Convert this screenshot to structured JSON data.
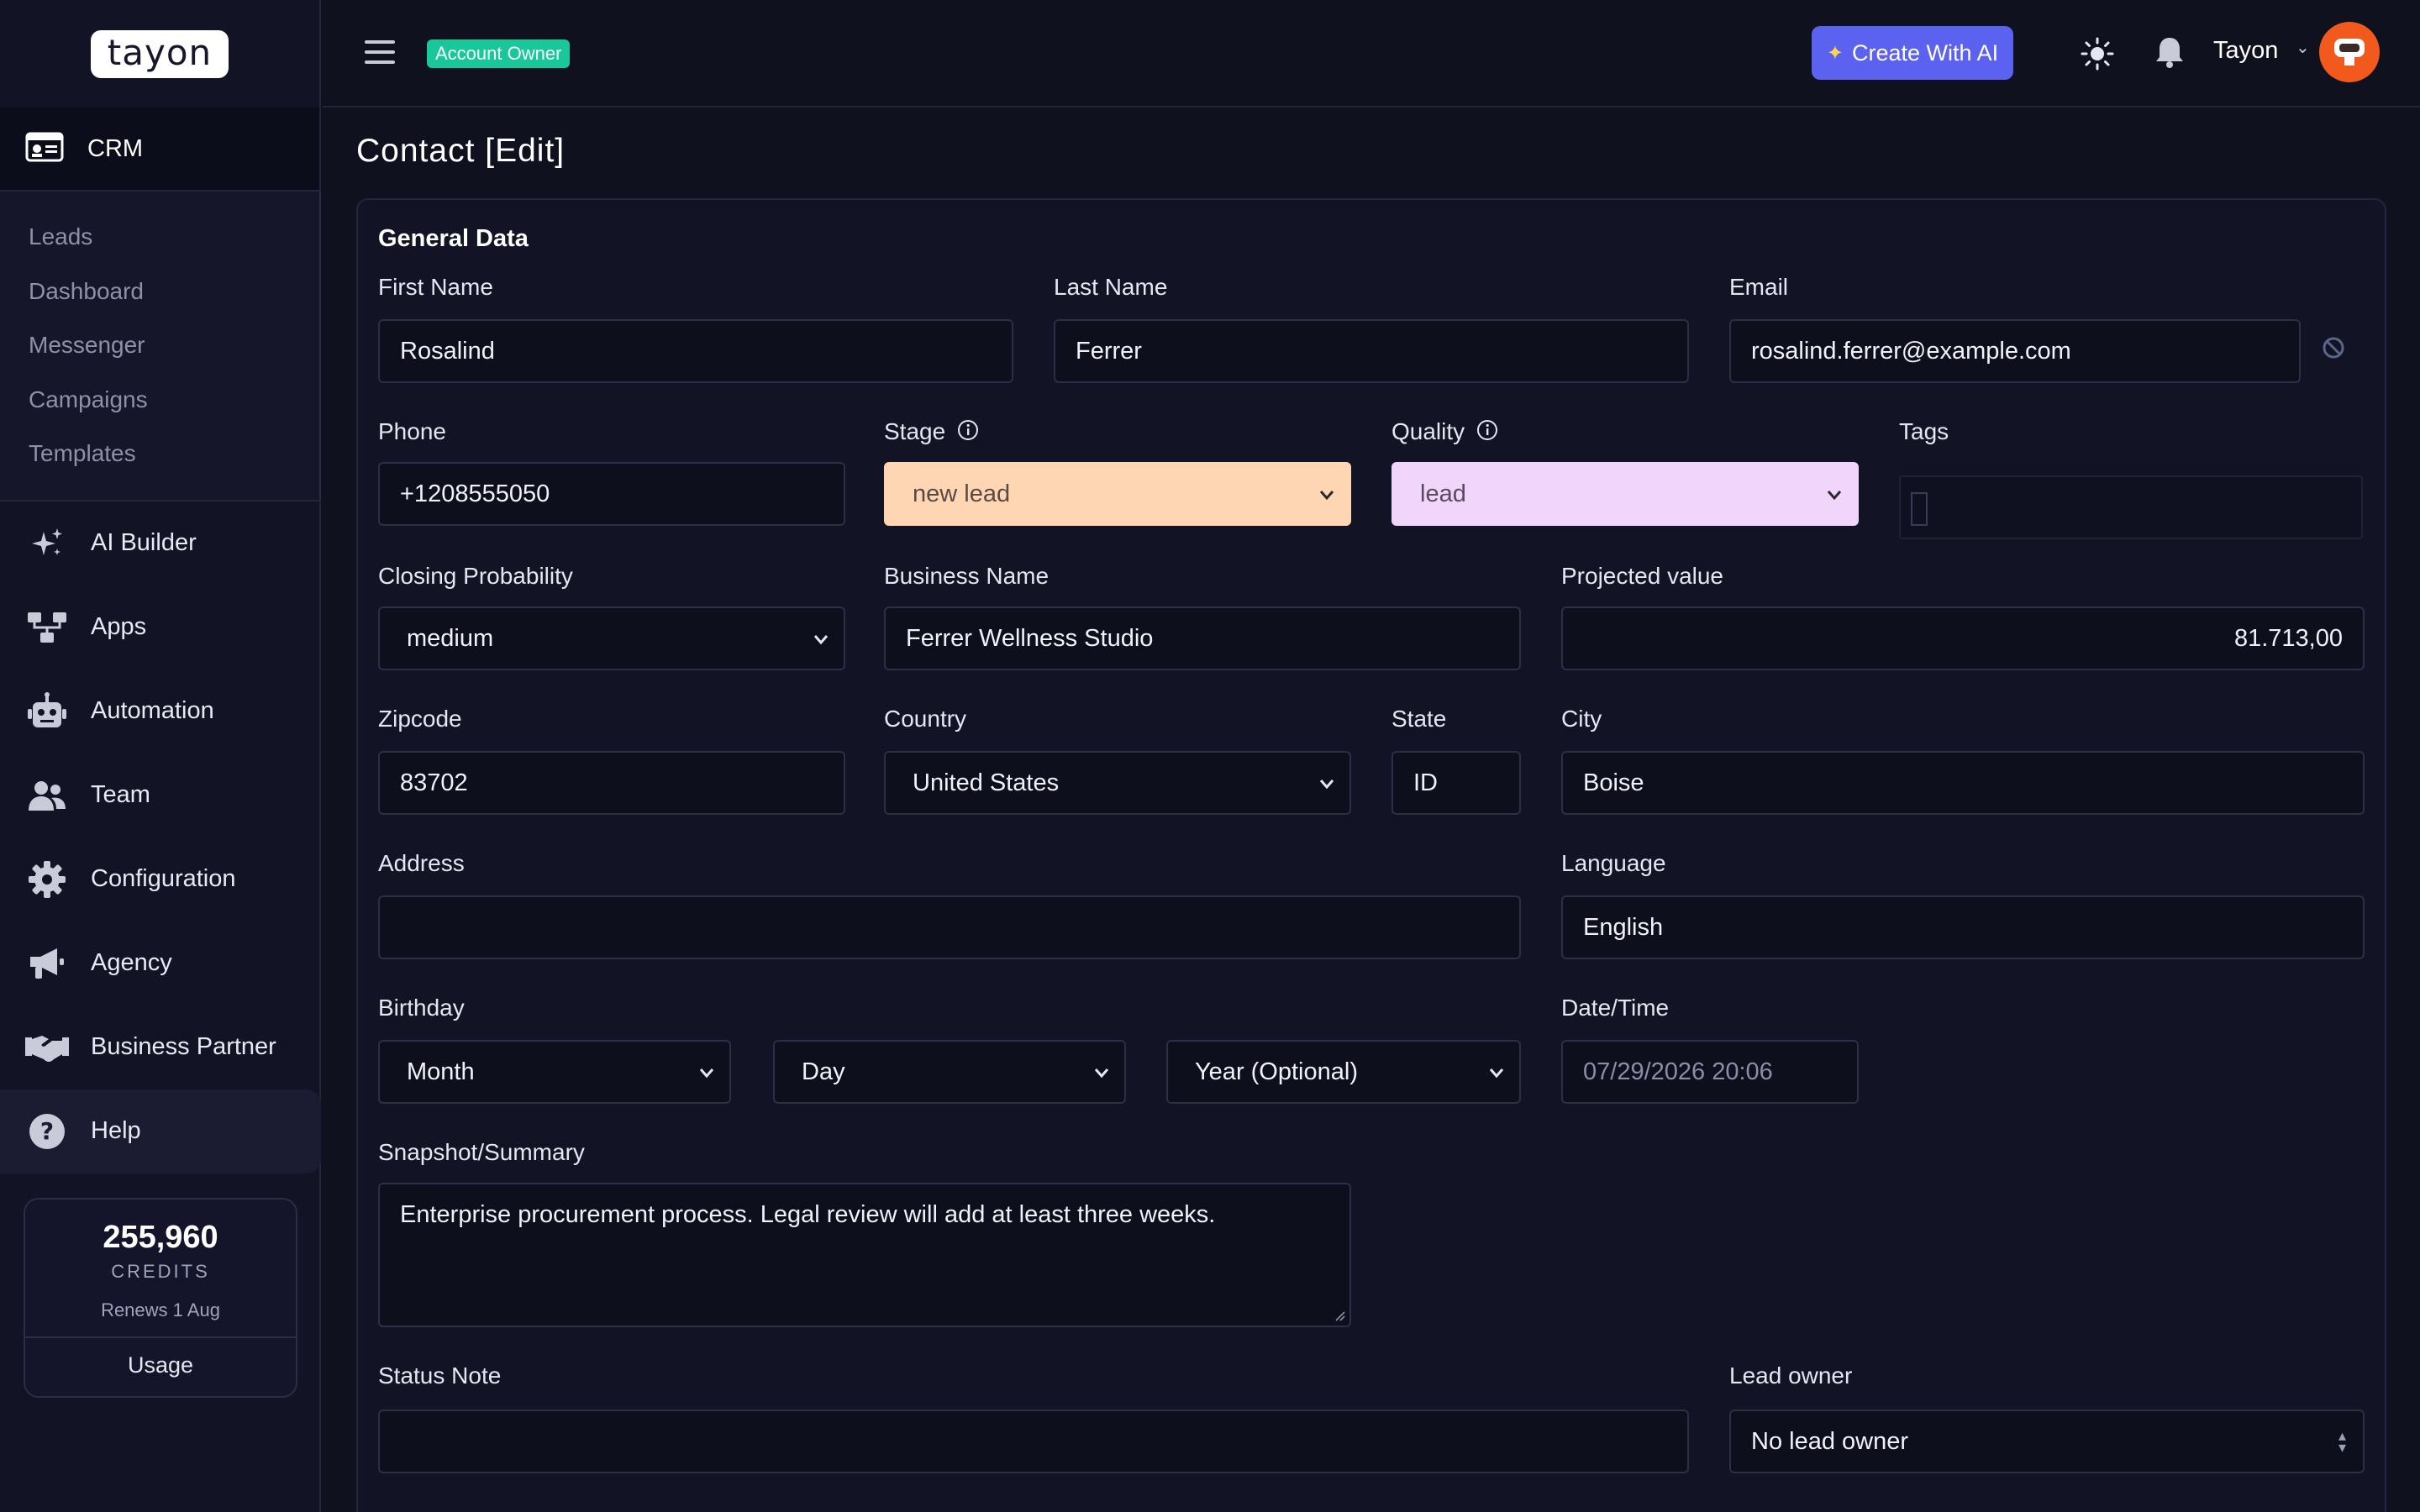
{
  "brand": {
    "logo_text": "tayon"
  },
  "sidebar": {
    "section": {
      "label": "CRM",
      "icon": "id-card-icon"
    },
    "subitems": [
      "Leads",
      "Dashboard",
      "Messenger",
      "Campaigns",
      "Templates"
    ],
    "items": [
      {
        "label": "AI Builder",
        "icon": "sparkles-icon"
      },
      {
        "label": "Apps",
        "icon": "sitemap-icon"
      },
      {
        "label": "Automation",
        "icon": "robot-icon"
      },
      {
        "label": "Team",
        "icon": "users-icon"
      },
      {
        "label": "Configuration",
        "icon": "gear-icon"
      },
      {
        "label": "Agency",
        "icon": "megaphone-icon"
      },
      {
        "label": "Business Partner",
        "icon": "handshake-icon"
      },
      {
        "label": "Help",
        "icon": "question-circle-icon"
      }
    ],
    "credits": {
      "amount": "255,960",
      "label": "CREDITS",
      "renews": "Renews 1 Aug",
      "usage_label": "Usage"
    }
  },
  "topbar": {
    "role_badge": "Account Owner",
    "create_ai_label": "Create With AI",
    "user_name": "Tayon"
  },
  "page": {
    "title": "Contact [Edit]"
  },
  "form": {
    "section_title": "General Data",
    "first_name": {
      "label": "First Name",
      "value": "Rosalind"
    },
    "last_name": {
      "label": "Last Name",
      "value": "Ferrer"
    },
    "email": {
      "label": "Email",
      "value": "rosalind.ferrer@example.com"
    },
    "phone": {
      "label": "Phone",
      "value": "+1208555050"
    },
    "stage": {
      "label": "Stage",
      "value": "new lead",
      "color": "#ffd6b3"
    },
    "quality": {
      "label": "Quality",
      "value": "lead",
      "color": "#f1d5fb"
    },
    "tags": {
      "label": "Tags",
      "value": ""
    },
    "closing_probability": {
      "label": "Closing Probability",
      "value": "medium"
    },
    "business_name": {
      "label": "Business Name",
      "value": "Ferrer Wellness Studio"
    },
    "projected_value": {
      "label": "Projected value",
      "value": "81.713,00"
    },
    "zipcode": {
      "label": "Zipcode",
      "value": "83702"
    },
    "country": {
      "label": "Country",
      "value": "United States"
    },
    "state": {
      "label": "State",
      "value": "ID"
    },
    "city": {
      "label": "City",
      "value": "Boise"
    },
    "address": {
      "label": "Address",
      "value": ""
    },
    "language": {
      "label": "Language",
      "value": "English"
    },
    "birthday": {
      "label": "Birthday",
      "month": "Month",
      "day": "Day",
      "year": "Year (Optional)"
    },
    "datetime": {
      "label": "Date/Time",
      "value": "07/29/2026 20:06"
    },
    "summary": {
      "label": "Snapshot/Summary",
      "value": "Enterprise procurement process. Legal review will add at least three weeks."
    },
    "status_note": {
      "label": "Status Note",
      "value": ""
    },
    "lead_owner": {
      "label": "Lead owner",
      "value": "No lead owner"
    }
  },
  "colors": {
    "accent": "#5b62f0",
    "badge": "#18c79a",
    "avatar": "#f25a1d"
  }
}
